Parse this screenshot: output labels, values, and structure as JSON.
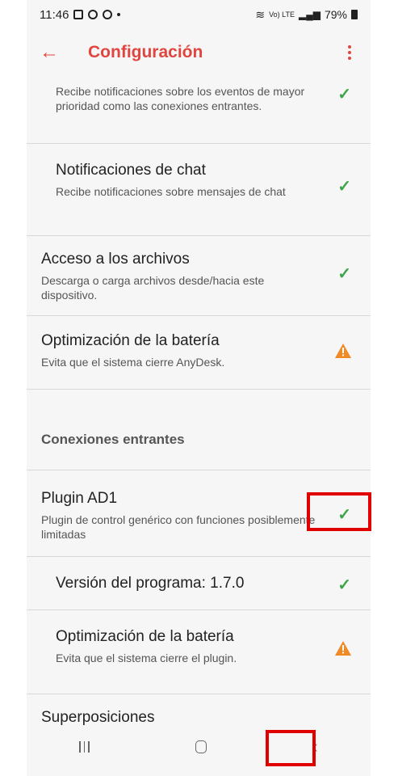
{
  "status_bar": {
    "time": "11:46",
    "network": "Vo) LTE",
    "battery": "79%"
  },
  "appbar": {
    "title": "Configuración"
  },
  "items": [
    {
      "title": "",
      "desc": "Recibe notificaciones sobre los eventos de mayor prioridad como las conexiones entrantes.",
      "status": "check"
    },
    {
      "title": "Notificaciones de chat",
      "desc": "Recibe notificaciones sobre mensajes de chat",
      "status": "check"
    },
    {
      "title": "Acceso a los archivos",
      "desc": "Descarga o carga archivos desde/hacia este dispositivo.",
      "status": "check"
    },
    {
      "title": "Optimización de la batería",
      "desc": "Evita que el sistema cierre AnyDesk.",
      "status": "warning"
    },
    {
      "title": "Plugin AD1",
      "desc": "Plugin de control genérico con funciones posiblemente limitadas",
      "status": "check"
    },
    {
      "title": "Versión del programa: 1.7.0",
      "desc": "",
      "status": "check"
    },
    {
      "title": "Optimización de la batería",
      "desc": "Evita que el sistema cierre el plugin.",
      "status": "warning"
    },
    {
      "title": "Superposiciones",
      "desc": "",
      "status": "warning"
    }
  ],
  "section": {
    "label": "Conexiones entrantes"
  },
  "icons": {
    "check": "check-icon",
    "warning": "warning-icon"
  },
  "colors": {
    "accent": "#e0453f",
    "check": "#3fa54a",
    "warning": "#f08a24"
  }
}
